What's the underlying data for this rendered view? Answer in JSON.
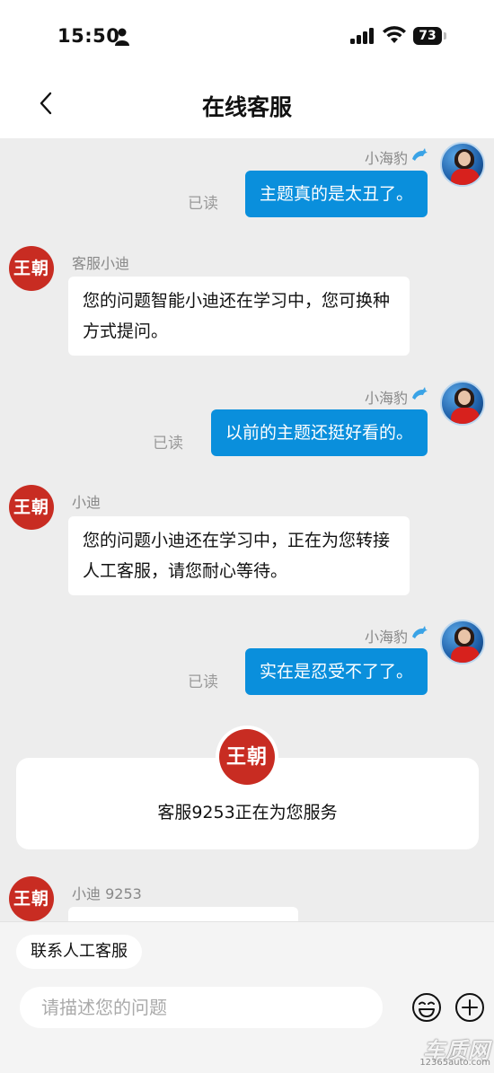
{
  "status_bar": {
    "time": "15:50",
    "battery": "73"
  },
  "nav": {
    "title": "在线客服"
  },
  "messages": [
    {
      "side": "right",
      "sender": "小海豹",
      "text": "主题真的是太丑了。",
      "read": "已读"
    },
    {
      "side": "left",
      "sender": "客服小迪",
      "text": "您的问题智能小迪还在学习中，您可换种方式提问。"
    },
    {
      "side": "right",
      "sender": "小海豹",
      "text": "以前的主题还挺好看的。",
      "read": "已读"
    },
    {
      "side": "left",
      "sender": "小迪",
      "text": "您的问题小迪还在学习中，正在为您转接人工客服，请您耐心等待。"
    },
    {
      "side": "right",
      "sender": "小海豹",
      "text": "实在是忍受不了了。",
      "read": "已读"
    }
  ],
  "service_notice": {
    "logo_text": "王朝",
    "text": "客服9253正在为您服务"
  },
  "last_message": {
    "sender": "小迪 9253"
  },
  "bot_avatar_text": "王朝",
  "bottom_bar": {
    "quick_reply": "联系人工客服",
    "input_placeholder": "请描述您的问题"
  },
  "watermark": {
    "title": "车质网",
    "url": "12365auto.com"
  },
  "colors": {
    "user_bubble": "#0a8fdc",
    "brand_red": "#c82c22",
    "chat_bg": "#ededed"
  }
}
